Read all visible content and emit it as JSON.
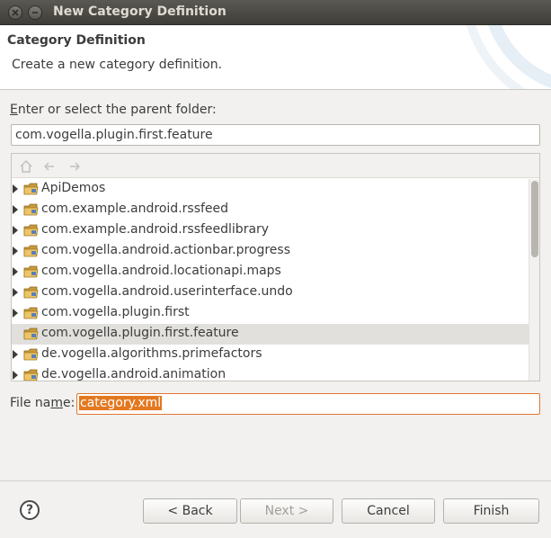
{
  "window": {
    "title": "New Category Definition"
  },
  "banner": {
    "title": "Category Definition",
    "description": "Create a new category definition."
  },
  "parent_folder": {
    "label_prefix": "",
    "label_accel": "E",
    "label_rest": "nter or select the parent folder:",
    "value": "com.vogella.plugin.first.feature"
  },
  "tree": {
    "toolbar": [
      "home-icon",
      "back-arrow-icon",
      "forward-arrow-icon"
    ],
    "items": [
      {
        "label": "ApiDemos",
        "expandable": true,
        "selected": false
      },
      {
        "label": "com.example.android.rssfeed",
        "expandable": true,
        "selected": false
      },
      {
        "label": "com.example.android.rssfeedlibrary",
        "expandable": true,
        "selected": false
      },
      {
        "label": "com.vogella.android.actionbar.progress",
        "expandable": true,
        "selected": false
      },
      {
        "label": "com.vogella.android.locationapi.maps",
        "expandable": true,
        "selected": false
      },
      {
        "label": "com.vogella.android.userinterface.undo",
        "expandable": true,
        "selected": false
      },
      {
        "label": "com.vogella.plugin.first",
        "expandable": true,
        "selected": false
      },
      {
        "label": "com.vogella.plugin.first.feature",
        "expandable": false,
        "selected": true
      },
      {
        "label": "de.vogella.algorithms.primefactors",
        "expandable": true,
        "selected": false
      },
      {
        "label": "de.vogella.android.animation",
        "expandable": true,
        "selected": false
      }
    ]
  },
  "file_name": {
    "label_pre": "File na",
    "label_accel": "m",
    "label_post": "e:",
    "value": "category.xml"
  },
  "buttons": {
    "help": "?",
    "back": "< Back",
    "next": "Next >",
    "cancel": "Cancel",
    "finish": "Finish"
  },
  "colors": {
    "selection": "#e4781f",
    "title_bar": "#3e3d39",
    "folder_icon": "#d8a43a"
  }
}
